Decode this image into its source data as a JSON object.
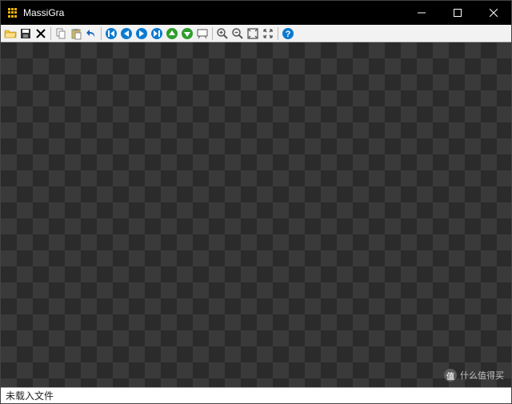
{
  "titlebar": {
    "app_name": "MassiGra"
  },
  "statusbar": {
    "message": "未载入文件"
  },
  "watermark": {
    "text": "什么值得买"
  },
  "toolbar": {
    "open": "Open",
    "save": "Save",
    "close": "Close",
    "copy": "Copy",
    "paste": "Paste",
    "undo": "Undo",
    "first": "First",
    "prev": "Previous",
    "next": "Next",
    "last": "Last",
    "up": "Up",
    "down": "Down",
    "slideshow": "Slideshow",
    "zoom_in": "Zoom In",
    "zoom_out": "Zoom Out",
    "fit": "Fit",
    "actual": "Actual Size",
    "help": "Help"
  }
}
